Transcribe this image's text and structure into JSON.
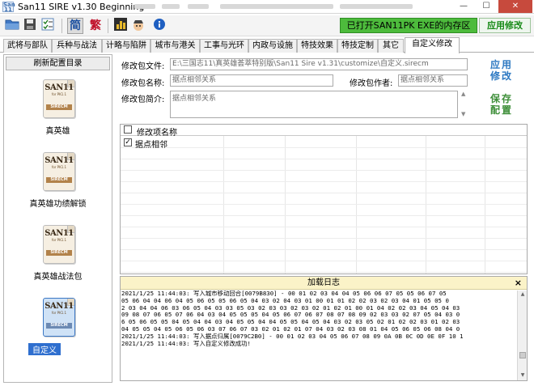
{
  "window": {
    "title": "San11 SIRE v1.30 Beginning",
    "app_icon_text": "San 11"
  },
  "toolbar": {
    "simplified_label": "简",
    "traditional_label": "繁",
    "status_text": "已打开SAN11PK EXE的内存区",
    "apply_label": "应用修改"
  },
  "tabs": [
    "武将与部队",
    "兵种与战法",
    "计略与陷阱",
    "城市与港关",
    "工事与光环",
    "内政与设施",
    "特技效果",
    "特技定制",
    "其它",
    "自定义修改"
  ],
  "active_tab_index": 9,
  "sidebar": {
    "refresh_label": "刷新配置目录",
    "plugins": [
      {
        "label": "真英雄",
        "selected": false
      },
      {
        "label": "真英雄功绩解锁",
        "selected": false
      },
      {
        "label": "真英雄战法包",
        "selected": false
      },
      {
        "label": "自定义",
        "selected": true
      }
    ],
    "pkg_logo": "SAN11",
    "pkg_sub": "for PK1.1",
    "pkg_bar": "SIRECM"
  },
  "form": {
    "file_label": "修改包文件:",
    "file_value": "E:\\三国志11\\真英雄荟萃特别版\\San11 Sire v1.31\\customize\\自定义.sirecm",
    "name_label": "修改包名称:",
    "name_value": "据点相邻关系",
    "author_label": "修改包作者:",
    "author_value": "据点相邻关系",
    "desc_label": "修改包简介:",
    "desc_value": "据点相邻关系",
    "apply_button": "应用修改",
    "save_button": "保存配置"
  },
  "item_list": {
    "header": "修改项名称",
    "items": [
      {
        "name": "据点相邻",
        "checked": true
      }
    ]
  },
  "log": {
    "title": "加载日志",
    "close_label": "×",
    "lines": [
      "2021/1/25 11:44:03: 写入城市移动回合[0079B830] - 00 01 02 03 04 04 05 06 06 07 05 05 06 07 05",
      "05 06 04 04 06 04 05 06 05 05 06 05 04 03 02 04 03 01 00 01 01 02 02 03 02 03 04 01 05 05 0",
      "2 03 04 04 06 03 06 05 04 03 03 05 03 02 03 03 02 03 02 01 02 01 00 01 04 02 02 03 04 05 04 03",
      "09 08 07 06 05 07 06 04 03 04 05 05 05 04 05 06 07 06 07 08 07 08 09 02 03 03 02 07 05 04 03 0",
      "6 05 06 05 05 04 05 04 04 03 04 05 05 04 04 05 05 04 05 04 03 02 03 05 02 01 02 02 03 01 02 03",
      "04 05 05 04 05 06 05 06 03 07 06 07 03 02 01 02 01 07 04 03 02 03 08 01 04 05 06 05 06 08 04 0",
      "2021/1/25 11:44:03: 写入据点归属[0079C2B0] - 00 01 02 03 04 05 06 07 08 09 0A 0B 0C 0D 0E 0F 10 1",
      "2021/1/25 11:44:03: 写入自定义修改成功!"
    ]
  }
}
